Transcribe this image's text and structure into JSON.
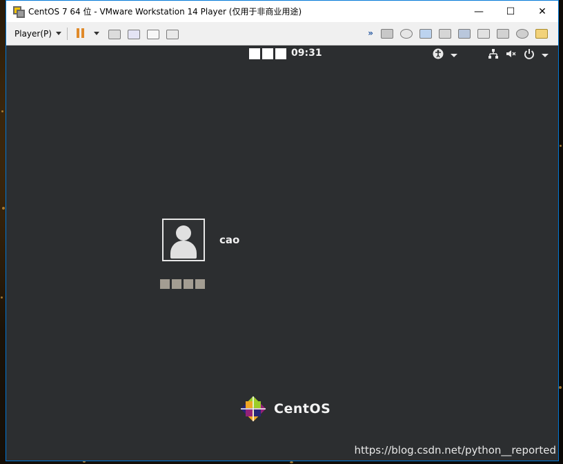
{
  "window": {
    "title": "CentOS 7 64 位 - VMware Workstation 14 Player (仅用于非商业用途)",
    "controls": {
      "minimize": "—",
      "maximize": "☐",
      "close": "✕"
    }
  },
  "toolbar": {
    "player_menu_label": "Player(P)",
    "icons_left": [
      "pause-icon",
      "send-ctrl-alt-del-icon",
      "unity-icon",
      "fullscreen-icon",
      "no-scale-icon"
    ],
    "icons_right": [
      "more-icon",
      "hard-disk-icon",
      "cd-dvd-icon",
      "network-adapter-icon",
      "printer-icon",
      "sound-card-icon",
      "usb-icon",
      "floppy-icon",
      "camera-icon",
      "message-log-icon"
    ]
  },
  "guest": {
    "clock": "09:31",
    "username": "cao",
    "brand": "CentOS",
    "status_icons": [
      "accessibility-icon",
      "network-icon",
      "volume-muted-icon",
      "power-icon"
    ]
  },
  "watermark": "https://blog.csdn.net/python__reported"
}
